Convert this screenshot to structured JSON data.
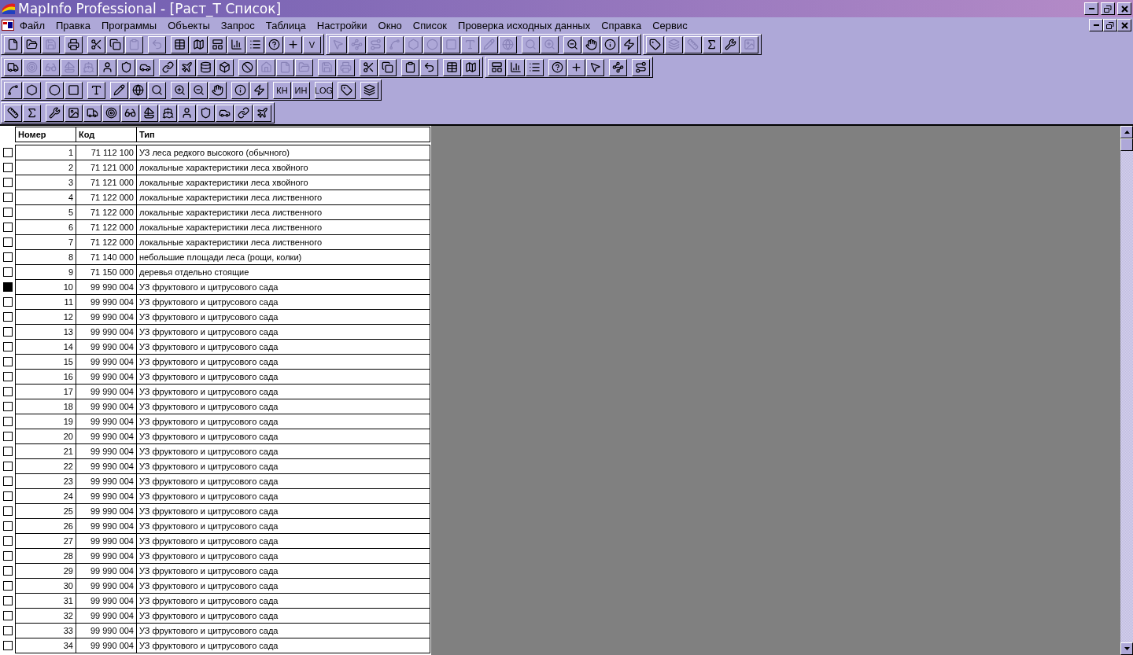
{
  "window": {
    "title": "MapInfo Professional - [Раст_Т Список]"
  },
  "menu": [
    "Файл",
    "Правка",
    "Программы",
    "Объекты",
    "Запрос",
    "Таблица",
    "Настройки",
    "Окно",
    "Список",
    "Проверка исходных данных",
    "Справка",
    "Сервис"
  ],
  "toolbar_rows": [
    [
      {
        "clusters": [
          [
            {
              "kind": "icon",
              "disabled": false
            },
            {
              "kind": "icon",
              "disabled": false
            },
            {
              "kind": "icon",
              "disabled": true
            }
          ],
          [
            {
              "kind": "icon",
              "disabled": false
            }
          ],
          [
            {
              "kind": "icon",
              "disabled": false
            },
            {
              "kind": "icon",
              "disabled": false
            },
            {
              "kind": "icon",
              "disabled": true
            }
          ],
          [
            {
              "kind": "icon",
              "disabled": true
            }
          ],
          [
            {
              "kind": "icon",
              "disabled": false
            },
            {
              "kind": "icon",
              "disabled": false
            },
            {
              "kind": "icon",
              "disabled": false
            },
            {
              "kind": "icon",
              "disabled": false
            },
            {
              "kind": "icon",
              "disabled": false
            },
            {
              "kind": "icon",
              "disabled": false
            },
            {
              "kind": "icon",
              "disabled": false
            },
            {
              "kind": "text",
              "label": "V",
              "disabled": false
            }
          ]
        ]
      },
      {
        "clusters": [
          [
            {
              "kind": "icon",
              "disabled": true
            },
            {
              "kind": "icon",
              "disabled": true
            },
            {
              "kind": "icon",
              "disabled": true
            },
            {
              "kind": "icon",
              "disabled": true
            },
            {
              "kind": "icon",
              "disabled": true
            },
            {
              "kind": "icon",
              "disabled": true
            },
            {
              "kind": "icon",
              "disabled": true
            },
            {
              "kind": "icon",
              "disabled": true
            },
            {
              "kind": "icon",
              "disabled": true
            },
            {
              "kind": "icon",
              "disabled": true
            }
          ],
          [
            {
              "kind": "icon",
              "disabled": true
            },
            {
              "kind": "icon",
              "disabled": true
            }
          ],
          [
            {
              "kind": "icon",
              "disabled": false
            },
            {
              "kind": "icon",
              "disabled": false
            },
            {
              "kind": "icon",
              "disabled": false
            },
            {
              "kind": "icon",
              "disabled": false
            }
          ]
        ]
      },
      {
        "clusters": [
          [
            {
              "kind": "icon",
              "disabled": false
            },
            {
              "kind": "icon",
              "disabled": true
            },
            {
              "kind": "icon",
              "disabled": true
            },
            {
              "kind": "icon",
              "disabled": false
            },
            {
              "kind": "icon",
              "disabled": false
            },
            {
              "kind": "icon",
              "disabled": true
            }
          ]
        ]
      }
    ],
    [
      {
        "clusters": [
          [
            {
              "kind": "icon",
              "disabled": false
            },
            {
              "kind": "icon",
              "disabled": true
            },
            {
              "kind": "icon",
              "disabled": true
            },
            {
              "kind": "icon",
              "disabled": true
            },
            {
              "kind": "icon",
              "disabled": true
            },
            {
              "kind": "icon",
              "disabled": false
            },
            {
              "kind": "icon",
              "disabled": false
            },
            {
              "kind": "icon",
              "disabled": false
            }
          ],
          [
            {
              "kind": "icon",
              "disabled": false
            },
            {
              "kind": "icon",
              "disabled": false
            },
            {
              "kind": "icon",
              "disabled": false
            },
            {
              "kind": "icon",
              "disabled": false
            }
          ],
          [
            {
              "kind": "icon",
              "disabled": false
            },
            {
              "kind": "icon",
              "disabled": true
            },
            {
              "kind": "icon",
              "disabled": true
            },
            {
              "kind": "icon",
              "disabled": true
            }
          ],
          [
            {
              "kind": "icon",
              "disabled": true
            },
            {
              "kind": "icon",
              "disabled": true
            }
          ],
          [
            {
              "kind": "icon",
              "disabled": false
            },
            {
              "kind": "icon",
              "disabled": false
            }
          ],
          [
            {
              "kind": "icon",
              "disabled": false
            },
            {
              "kind": "icon",
              "disabled": false
            }
          ],
          [
            {
              "kind": "icon",
              "disabled": false
            },
            {
              "kind": "icon",
              "disabled": false
            }
          ]
        ]
      },
      {
        "clusters": [
          [
            {
              "kind": "icon",
              "disabled": false
            },
            {
              "kind": "icon",
              "disabled": false
            },
            {
              "kind": "icon",
              "disabled": false
            }
          ],
          [
            {
              "kind": "icon",
              "disabled": false
            },
            {
              "kind": "icon",
              "disabled": false
            },
            {
              "kind": "icon",
              "disabled": false
            }
          ],
          [
            {
              "kind": "icon",
              "disabled": false
            }
          ],
          [
            {
              "kind": "icon",
              "disabled": false
            }
          ]
        ]
      }
    ],
    [
      {
        "clusters": [
          [
            {
              "kind": "icon",
              "disabled": false
            },
            {
              "kind": "icon",
              "disabled": false
            }
          ],
          [
            {
              "kind": "icon",
              "disabled": false
            },
            {
              "kind": "icon",
              "disabled": false
            }
          ],
          [
            {
              "kind": "icon",
              "disabled": false
            }
          ],
          [
            {
              "kind": "icon",
              "disabled": false
            },
            {
              "kind": "icon",
              "disabled": false
            },
            {
              "kind": "icon",
              "disabled": false
            }
          ],
          [
            {
              "kind": "icon",
              "disabled": false
            },
            {
              "kind": "icon",
              "disabled": false
            },
            {
              "kind": "icon",
              "disabled": false
            }
          ],
          [
            {
              "kind": "icon",
              "disabled": false
            },
            {
              "kind": "icon",
              "disabled": false
            }
          ],
          [
            {
              "kind": "text",
              "label": "КН",
              "disabled": false
            },
            {
              "kind": "text",
              "label": "ИН",
              "disabled": false
            }
          ],
          [
            {
              "kind": "text",
              "label": "LOG",
              "disabled": false
            }
          ],
          [
            {
              "kind": "icon",
              "disabled": false
            }
          ],
          [
            {
              "kind": "icon",
              "disabled": false
            }
          ]
        ]
      }
    ],
    [
      {
        "clusters": [
          [
            {
              "kind": "icon",
              "disabled": false
            },
            {
              "kind": "icon",
              "disabled": false
            }
          ],
          [
            {
              "kind": "icon",
              "disabled": false
            },
            {
              "kind": "icon",
              "disabled": false
            },
            {
              "kind": "icon",
              "disabled": false
            },
            {
              "kind": "icon",
              "disabled": false
            },
            {
              "kind": "icon",
              "disabled": false
            },
            {
              "kind": "icon",
              "disabled": false
            },
            {
              "kind": "icon",
              "disabled": false
            },
            {
              "kind": "icon",
              "disabled": false
            },
            {
              "kind": "icon",
              "disabled": false
            },
            {
              "kind": "icon",
              "disabled": false
            },
            {
              "kind": "icon",
              "disabled": false
            },
            {
              "kind": "icon",
              "disabled": false
            }
          ]
        ]
      }
    ]
  ],
  "table": {
    "columns": [
      "Номер",
      "Код",
      "Тип"
    ],
    "rows": [
      {
        "cells": [
          "1",
          "71 112 100",
          "УЗ леса редкого высокого (обычного)"
        ],
        "selected": false
      },
      {
        "cells": [
          "2",
          "71 121 000",
          "локальные характеристики леса хвойного"
        ],
        "selected": false
      },
      {
        "cells": [
          "3",
          "71 121 000",
          "локальные характеристики леса хвойного"
        ],
        "selected": false
      },
      {
        "cells": [
          "4",
          "71 122 000",
          "локальные характеристики леса лиственного"
        ],
        "selected": false
      },
      {
        "cells": [
          "5",
          "71 122 000",
          "локальные характеристики леса лиственного"
        ],
        "selected": false
      },
      {
        "cells": [
          "6",
          "71 122 000",
          "локальные характеристики леса лиственного"
        ],
        "selected": false
      },
      {
        "cells": [
          "7",
          "71 122 000",
          "локальные характеристики леса лиственного"
        ],
        "selected": false
      },
      {
        "cells": [
          "8",
          "71 140 000",
          "небольшие площади леса (рощи, колки)"
        ],
        "selected": false
      },
      {
        "cells": [
          "9",
          "71 150 000",
          "деревья отдельно стоящие"
        ],
        "selected": false
      },
      {
        "cells": [
          "10",
          "99 990 004",
          "УЗ фруктового и цитрусового сада"
        ],
        "selected": true
      },
      {
        "cells": [
          "11",
          "99 990 004",
          "УЗ фруктового и цитрусового сада"
        ],
        "selected": false
      },
      {
        "cells": [
          "12",
          "99 990 004",
          "УЗ фруктового и цитрусового сада"
        ],
        "selected": false
      },
      {
        "cells": [
          "13",
          "99 990 004",
          "УЗ фруктового и цитрусового сада"
        ],
        "selected": false
      },
      {
        "cells": [
          "14",
          "99 990 004",
          "УЗ фруктового и цитрусового сада"
        ],
        "selected": false
      },
      {
        "cells": [
          "15",
          "99 990 004",
          "УЗ фруктового и цитрусового сада"
        ],
        "selected": false
      },
      {
        "cells": [
          "16",
          "99 990 004",
          "УЗ фруктового и цитрусового сада"
        ],
        "selected": false
      },
      {
        "cells": [
          "17",
          "99 990 004",
          "УЗ фруктового и цитрусового сада"
        ],
        "selected": false
      },
      {
        "cells": [
          "18",
          "99 990 004",
          "УЗ фруктового и цитрусового сада"
        ],
        "selected": false
      },
      {
        "cells": [
          "19",
          "99 990 004",
          "УЗ фруктового и цитрусового сада"
        ],
        "selected": false
      },
      {
        "cells": [
          "20",
          "99 990 004",
          "УЗ фруктового и цитрусового сада"
        ],
        "selected": false
      },
      {
        "cells": [
          "21",
          "99 990 004",
          "УЗ фруктового и цитрусового сада"
        ],
        "selected": false
      },
      {
        "cells": [
          "22",
          "99 990 004",
          "УЗ фруктового и цитрусового сада"
        ],
        "selected": false
      },
      {
        "cells": [
          "23",
          "99 990 004",
          "УЗ фруктового и цитрусового сада"
        ],
        "selected": false
      },
      {
        "cells": [
          "24",
          "99 990 004",
          "УЗ фруктового и цитрусового сада"
        ],
        "selected": false
      },
      {
        "cells": [
          "25",
          "99 990 004",
          "УЗ фруктового и цитрусового сада"
        ],
        "selected": false
      },
      {
        "cells": [
          "26",
          "99 990 004",
          "УЗ фруктового и цитрусового сада"
        ],
        "selected": false
      },
      {
        "cells": [
          "27",
          "99 990 004",
          "УЗ фруктового и цитрусового сада"
        ],
        "selected": false
      },
      {
        "cells": [
          "28",
          "99 990 004",
          "УЗ фруктового и цитрусового сада"
        ],
        "selected": false
      },
      {
        "cells": [
          "29",
          "99 990 004",
          "УЗ фруктового и цитрусового сада"
        ],
        "selected": false
      },
      {
        "cells": [
          "30",
          "99 990 004",
          "УЗ фруктового и цитрусового сада"
        ],
        "selected": false
      },
      {
        "cells": [
          "31",
          "99 990 004",
          "УЗ фруктового и цитрусового сада"
        ],
        "selected": false
      },
      {
        "cells": [
          "32",
          "99 990 004",
          "УЗ фруктового и цитрусового сада"
        ],
        "selected": false
      },
      {
        "cells": [
          "33",
          "99 990 004",
          "УЗ фруктового и цитрусового сада"
        ],
        "selected": false
      },
      {
        "cells": [
          "34",
          "99 990 004",
          "УЗ фруктового и цитрусового сада"
        ],
        "selected": false
      }
    ]
  }
}
